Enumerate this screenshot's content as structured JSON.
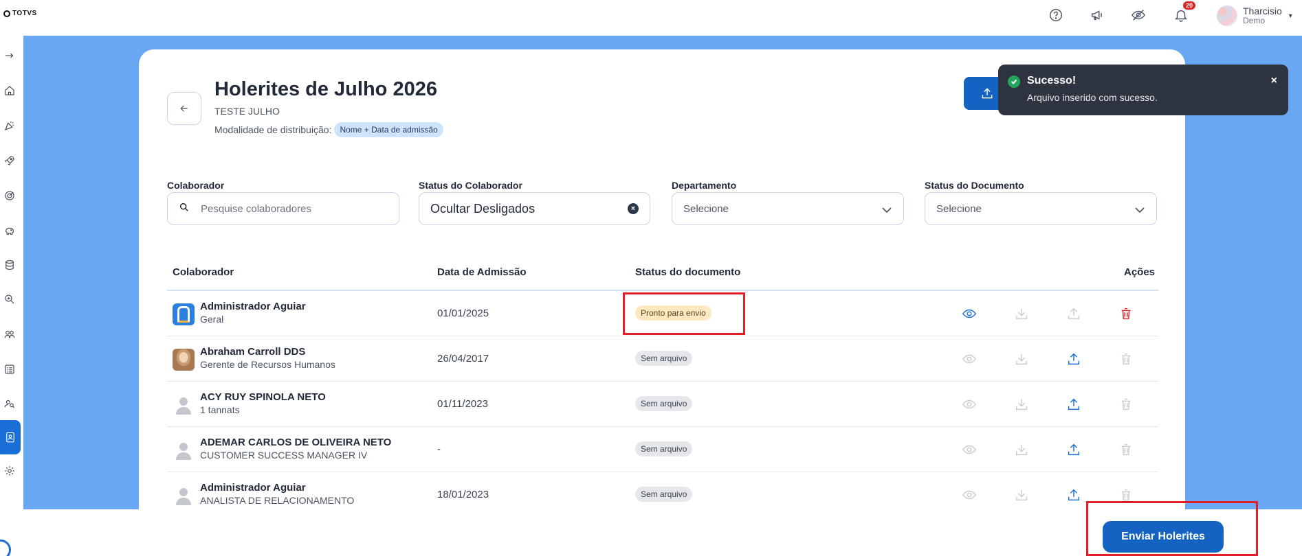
{
  "brand": {
    "logo_text": "TOTVS"
  },
  "topbar": {
    "notifications_count": "20",
    "user_name": "Tharcisio",
    "user_sub": "Demo",
    "icons": [
      "help-icon",
      "megaphone-icon",
      "eye-off-icon",
      "bell-icon"
    ]
  },
  "sidebar": {
    "icons": [
      "expand-icon",
      "home-icon",
      "celebration-icon",
      "rocket-icon",
      "target-icon",
      "piggy-bank-icon",
      "database-icon",
      "search-chart-icon",
      "people-icon",
      "checklist-icon",
      "people-search-icon",
      "document-user-icon",
      "gear-icon"
    ],
    "active": "document-user-icon"
  },
  "page": {
    "title": "Holerites de Julho 2026",
    "subtitle": "TESTE JULHO",
    "modalidade_label": "Modalidade de distribuição:",
    "modalidade_value": "Nome + Data de admissão"
  },
  "filters": {
    "colaborador": {
      "label": "Colaborador",
      "placeholder": "Pesquise colaboradores"
    },
    "status_colaborador": {
      "label": "Status do Colaborador",
      "value": "Ocultar Desligados"
    },
    "departamento": {
      "label": "Departamento",
      "value": "Selecione"
    },
    "status_documento": {
      "label": "Status do Documento",
      "value": "Selecione"
    }
  },
  "table": {
    "headers": {
      "colaborador": "Colaborador",
      "data": "Data de Admissão",
      "status": "Status do documento",
      "acoes": "Ações"
    },
    "rows": [
      {
        "name": "Administrador Aguiar",
        "role": "Geral",
        "date": "01/01/2025",
        "status": "Pronto para envio",
        "avatar": "logo"
      },
      {
        "name": "Abraham Carroll DDS",
        "role": "Gerente de Recursos Humanos",
        "date": "26/04/2017",
        "status": "Sem arquivo",
        "avatar": "photo"
      },
      {
        "name": "ACY RUY SPINOLA NETO",
        "role": "1 tannats",
        "date": "01/11/2023",
        "status": "Sem arquivo",
        "avatar": "generic"
      },
      {
        "name": "ADEMAR CARLOS DE OLIVEIRA NETO",
        "role": "CUSTOMER SUCCESS MANAGER IV",
        "date": "-",
        "status": "Sem arquivo",
        "avatar": "generic"
      },
      {
        "name": "Administrador Aguiar",
        "role": "ANALISTA DE RELACIONAMENTO",
        "date": "18/01/2023",
        "status": "Sem arquivo",
        "avatar": "generic"
      }
    ]
  },
  "toast": {
    "title": "Sucesso!",
    "message": "Arquivo inserido com sucesso.",
    "close": "×"
  },
  "footer": {
    "send_label": "Enviar Holerites"
  },
  "colors": {
    "primary": "#1463c2",
    "background_blue": "#6aa7f2",
    "danger": "#dc2626",
    "highlight": "#e11d2a"
  }
}
